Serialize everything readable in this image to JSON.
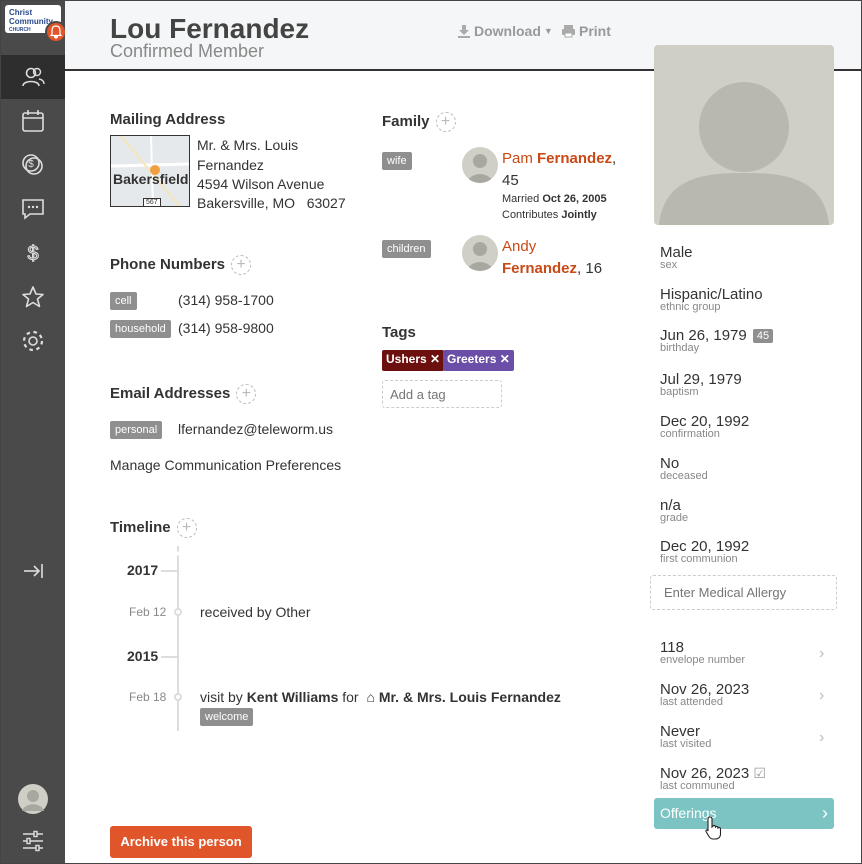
{
  "sidebar": {
    "logo_line1": "Christ",
    "logo_line2": "Community",
    "logo_line3": "CHURCH"
  },
  "header": {
    "name": "Lou Fernandez",
    "subtitle": "Confirmed Member",
    "download_label": "Download",
    "print_label": "Print"
  },
  "mailing": {
    "title": "Mailing Address",
    "map_label": "Bakersfield",
    "map_shield": "567",
    "name_line1": "Mr. & Mrs. Louis",
    "name_line2": "Fernandez",
    "street": "4594 Wilson Avenue",
    "city": "Bakersville, MO   63027"
  },
  "phones": {
    "title": "Phone Numbers",
    "items": [
      {
        "type": "cell",
        "number": "(314) 958-1700"
      },
      {
        "type": "household",
        "number": "(314) 958-9800"
      }
    ]
  },
  "emails": {
    "title": "Email Addresses",
    "items": [
      {
        "type": "personal",
        "address": "lfernandez@teleworm.us"
      }
    ],
    "manage_link": "Manage Communication Preferences"
  },
  "family": {
    "title": "Family",
    "wife": {
      "relation": "wife",
      "first": "Pam",
      "last": "Fernandez",
      "age": "45",
      "married_prefix": "Married",
      "married_date": "Oct 26, 2005",
      "contributes_prefix": "Contributes",
      "contributes": "Jointly"
    },
    "child": {
      "relation": "children",
      "first": "Andy",
      "last": "Fernandez",
      "age": "16"
    }
  },
  "tags": {
    "title": "Tags",
    "items": [
      {
        "label": "Ushers",
        "color": "#6b0f0f"
      },
      {
        "label": "Greeters",
        "color": "#6b4ea8"
      }
    ],
    "placeholder": "Add a tag"
  },
  "timeline": {
    "title": "Timeline",
    "years": [
      "2017",
      "2015"
    ],
    "events": [
      {
        "date": "Feb 12",
        "text": "received by Other"
      },
      {
        "date": "Feb 18",
        "prefix": "visit by",
        "person": "Kent Williams",
        "for": "for",
        "household": "Mr. & Mrs. Louis Fernandez",
        "badge": "welcome"
      }
    ]
  },
  "archive_button": "Archive this person",
  "facts": [
    {
      "value": "Male",
      "key": "sex"
    },
    {
      "value": "Hispanic/Latino",
      "key": "ethnic group"
    },
    {
      "value": "Jun 26, 1979",
      "key": "birthday",
      "badge": "45"
    },
    {
      "value": "Jul 29, 1979",
      "key": "baptism"
    },
    {
      "value": "Dec 20, 1992",
      "key": "confirmation"
    },
    {
      "value": "No",
      "key": "deceased"
    },
    {
      "value": "n/a",
      "key": "grade"
    },
    {
      "value": "Dec 20, 1992",
      "key": "first communion"
    }
  ],
  "allergy_placeholder": "Enter Medical Allergy",
  "stats": [
    {
      "value": "118",
      "key": "envelope number"
    },
    {
      "value": "Nov 26, 2023",
      "key": "last attended"
    },
    {
      "value": "Never",
      "key": "last visited"
    },
    {
      "value": "Nov 26, 2023",
      "key": "last communed"
    }
  ],
  "offerings_label": "Offerings",
  "colors": {
    "accent": "#c84a16",
    "offerings": "#7cc4c4",
    "sidebar": "#4a4a4a"
  }
}
